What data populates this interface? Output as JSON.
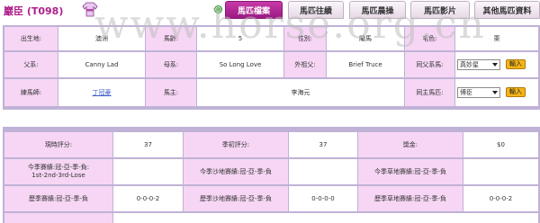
{
  "horse": {
    "name": "巖臣  (T098)"
  },
  "watermark": "www.horse.org.cn",
  "tabs": [
    {
      "label": "馬匹檔案",
      "active": true
    },
    {
      "label": "馬匹往績",
      "active": false
    },
    {
      "label": "馬匹晨操",
      "active": false
    },
    {
      "label": "馬匹影片",
      "active": false
    },
    {
      "label": "其他馬匹資料",
      "active": false
    }
  ],
  "profile": {
    "origin_label": "出生地:",
    "origin_value": "澳洲",
    "age_label": "馬齡:",
    "age_value": "5",
    "sex_label": "性別:",
    "sex_value": "閹馬",
    "colour_label": "毛色:",
    "colour_value": "栗",
    "sire_label": "父系:",
    "sire_value": "Canny Lad",
    "dam_label": "母系:",
    "dam_value": "So Long Love",
    "damsire_label": "外祖父:",
    "damsire_value": "Brief Truce",
    "same_sire_label": "同父系馬:",
    "same_sire_select": "真妙星",
    "trainer_label": "練馬師:",
    "trainer_value": "丁冠豪",
    "owner_label": "馬主:",
    "owner_value": "李海元",
    "same_owner_label": "同主馬匹:",
    "same_owner_select": "博臣",
    "enter_label": "輸入"
  },
  "stats": {
    "current_rating_label": "現時評分:",
    "current_rating_value": "37",
    "season_start_rating_label": "季初評分:",
    "season_start_rating_value": "37",
    "prize_label": "獎金:",
    "prize_value": "$0",
    "season_record_label_1": "今季賽績:冠-亞-季-負:",
    "season_record_label_2": "1st-2nd-3rd-Lose",
    "season_dirt_label": "今季沙地賽績:冠-亞-季-負",
    "season_turf_label": "今季草地賽績:冠-亞-季-負",
    "career_record_label": "歷季賽績:冠-亞-季-負",
    "career_record_value": "0-0-0-2",
    "career_dirt_label": "歷季沙地賽績:冠-亞-季-負",
    "career_dirt_value": "0-0-0-0",
    "career_turf_label": "歷季草地賽績:冠-亞-季-負",
    "career_turf_value": "0-0-0-2"
  },
  "colors": {
    "accent": "#b0208a",
    "panel_border": "#bfb2d6",
    "label_bg": "#f6d6f4",
    "button_bg": "#f3b418"
  }
}
